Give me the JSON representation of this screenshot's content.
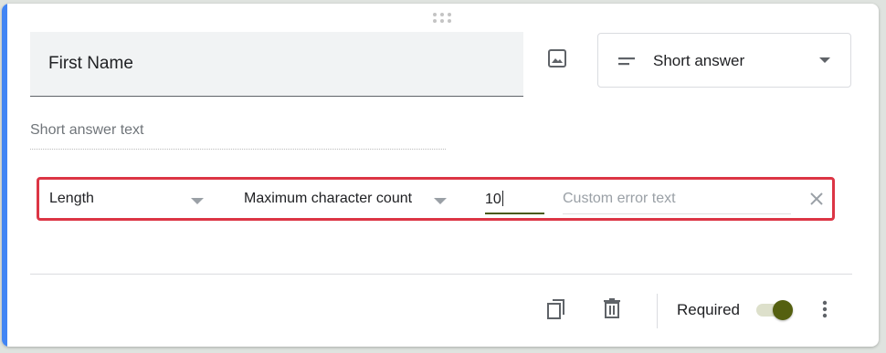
{
  "question": {
    "title": "First Name",
    "type_label": "Short answer",
    "answer_placeholder": "Short answer text"
  },
  "validation": {
    "rule_type": "Length",
    "rule_condition": "Maximum character count",
    "value": "10",
    "error_placeholder": "Custom error text"
  },
  "footer": {
    "required_label": "Required",
    "required_on": true
  },
  "colors": {
    "accent": "#4285f4",
    "toggle_on": "#556010",
    "highlight_border": "#dc3545"
  },
  "icons": {
    "drag": "drag-handle-icon",
    "image": "image-icon",
    "type": "short-text-icon",
    "dropdown": "arrow-drop-down-icon",
    "clear": "close-icon",
    "duplicate": "copy-icon",
    "delete": "trash-icon",
    "more": "more-vert-icon"
  }
}
